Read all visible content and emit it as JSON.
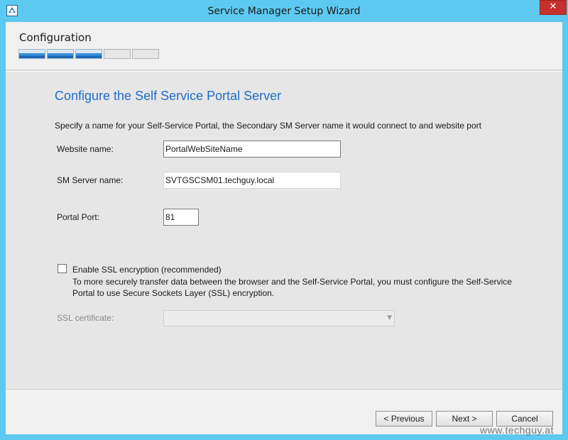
{
  "window": {
    "title": "Service Manager Setup Wizard",
    "accent": "#5ec9f0",
    "close_icon": "close-icon"
  },
  "header": {
    "title": "Configuration",
    "progress": {
      "completed_steps": 3,
      "total_steps": 5
    }
  },
  "page": {
    "title": "Configure the Self Service Portal Server",
    "description": "Specify a name for your Self-Service Portal, the Secondary SM Server name it would connect to and website port"
  },
  "form": {
    "website_name": {
      "label": "Website name:",
      "value": "PortalWebSiteName"
    },
    "sm_server_name": {
      "label": "SM Server name:",
      "value": "SVTGSCSM01.techguy.local"
    },
    "portal_port": {
      "label": "Portal Port:",
      "value": "81"
    },
    "ssl": {
      "label": "Enable SSL encryption (recommended)",
      "checked": false,
      "description": "To more securely transfer data between the browser and the Self-Service Portal, you must configure the Self-Service Portal to use Secure Sockets Layer (SSL) encryption."
    },
    "ssl_certificate": {
      "label": "SSL certificate:",
      "value": ""
    }
  },
  "footer": {
    "previous_label": "< Previous",
    "next_label": "Next >",
    "cancel_label": "Cancel"
  },
  "watermark": "www.techguy.at"
}
